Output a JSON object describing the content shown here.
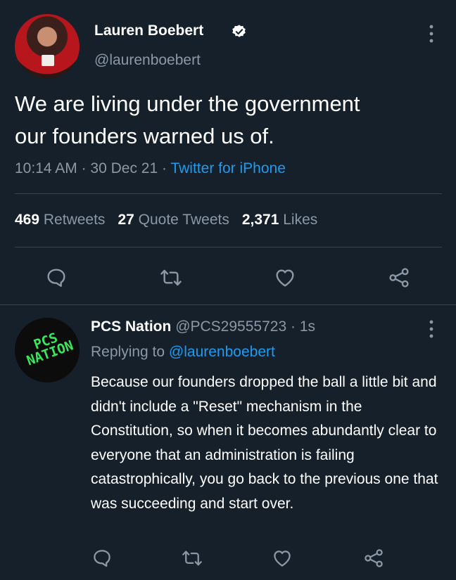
{
  "main_tweet": {
    "author_name": "Lauren Boebert",
    "handle": "@laurenboebert",
    "text_line1": "We are living under the government",
    "text_line2": "our founders warned us of.",
    "time": "10:14 AM",
    "date": "30 Dec 21",
    "source": "Twitter for iPhone",
    "retweets_count": "469",
    "retweets_label": "Retweets",
    "quotes_count": "27",
    "quotes_label": "Quote Tweets",
    "likes_count": "2,371",
    "likes_label": "Likes",
    "sep": "·"
  },
  "reply_tweet": {
    "author_name": "PCS Nation",
    "handle": "@PCS29555723",
    "time_ago": "1s",
    "replying_label": "Replying to",
    "replying_to": "@laurenboebert",
    "text": "Because our founders dropped the ball a little bit and didn't include a \"Reset\" mechanism in the Constitution, so when it becomes abundantly clear to everyone that an administration is failing catastrophically, you go back to the previous one that was succeeding and start over.",
    "avatar_logo_line1": "PCS",
    "avatar_logo_line2": "NATION"
  },
  "colors": {
    "background": "#15202b",
    "muted": "#8b98a5",
    "link": "#1d9bf0",
    "avatar_logo": "#38e85a"
  },
  "icons": [
    "verified-icon",
    "more-icon",
    "reply-icon",
    "retweet-icon",
    "like-icon",
    "share-icon"
  ]
}
